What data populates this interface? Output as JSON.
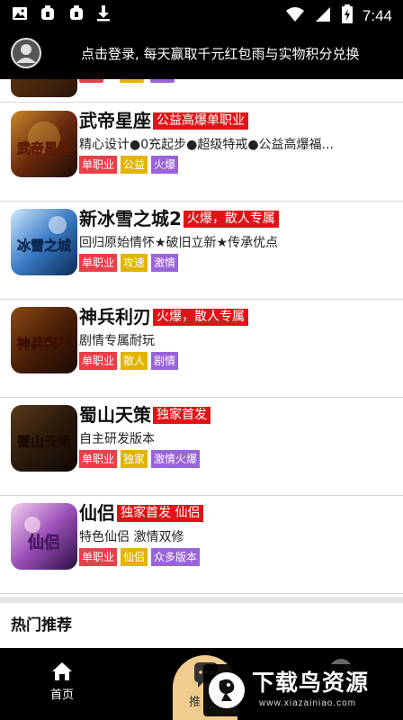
{
  "status_bar": {
    "time": "7:44",
    "left_icons": [
      "image-icon",
      "bug-icon",
      "bug-icon",
      "download-icon"
    ],
    "right_icons": [
      "wifi-icon",
      "signal-icon",
      "battery-charging-icon"
    ]
  },
  "login_banner": {
    "text": "点击登录, 每天赢取千元红包雨与实物积分兑换"
  },
  "games": [
    {
      "title": "武帝星座",
      "badge": "公益高爆单职业",
      "description": "精心设计●0充起步●超级特戒●公益高爆福...",
      "tags": [
        {
          "label": "单职业",
          "color": "red"
        },
        {
          "label": "公益",
          "color": "yellow"
        },
        {
          "label": "火爆",
          "color": "purple"
        }
      ],
      "thumb_text": "武帝星座"
    },
    {
      "title": "新冰雪之城2",
      "badge": "火爆，散人专属",
      "description": "回归原始情怀★破旧立新★传承优点",
      "tags": [
        {
          "label": "单职业",
          "color": "red"
        },
        {
          "label": "攻速",
          "color": "yellow"
        },
        {
          "label": "激情",
          "color": "purple"
        }
      ],
      "thumb_text": "冰雪之城"
    },
    {
      "title": "神兵利刃",
      "badge": "火爆，散人专属",
      "description": "剧情专属耐玩",
      "tags": [
        {
          "label": "单职业",
          "color": "red"
        },
        {
          "label": "散人",
          "color": "yellow"
        },
        {
          "label": "剧情",
          "color": "purple"
        }
      ],
      "thumb_text": "神兵利刃"
    },
    {
      "title": "蜀山天策",
      "badge": "独家首发",
      "description": "自主研发版本",
      "tags": [
        {
          "label": "单职业",
          "color": "red"
        },
        {
          "label": "独家",
          "color": "yellow"
        },
        {
          "label": "激情火爆",
          "color": "purple"
        }
      ],
      "thumb_text": "蜀山天策"
    },
    {
      "title": "仙侣",
      "badge": "独家首发 仙侣",
      "description": "特色仙侣 激情双修",
      "tags": [
        {
          "label": "单职业",
          "color": "red"
        },
        {
          "label": "仙侣",
          "color": "yellow"
        },
        {
          "label": "众多版本",
          "color": "purple"
        }
      ],
      "thumb_text": "仙侣"
    }
  ],
  "section": {
    "title": "热门推荐"
  },
  "tab_bar": {
    "home_label": "首页",
    "center_label": "推",
    "icons": [
      "home-icon",
      "chat-icon",
      "user-icon"
    ]
  },
  "watermark": {
    "main": "下载鸟资源",
    "sub": "www.xiazainiao.com"
  },
  "colors": {
    "badge_red": "#e01418",
    "tag_red": "#e8404a",
    "tag_yellow": "#e2b400",
    "tag_purple": "#9a63d8",
    "bar_black": "#000000",
    "center_tab_gold": "#f0cd8f"
  }
}
